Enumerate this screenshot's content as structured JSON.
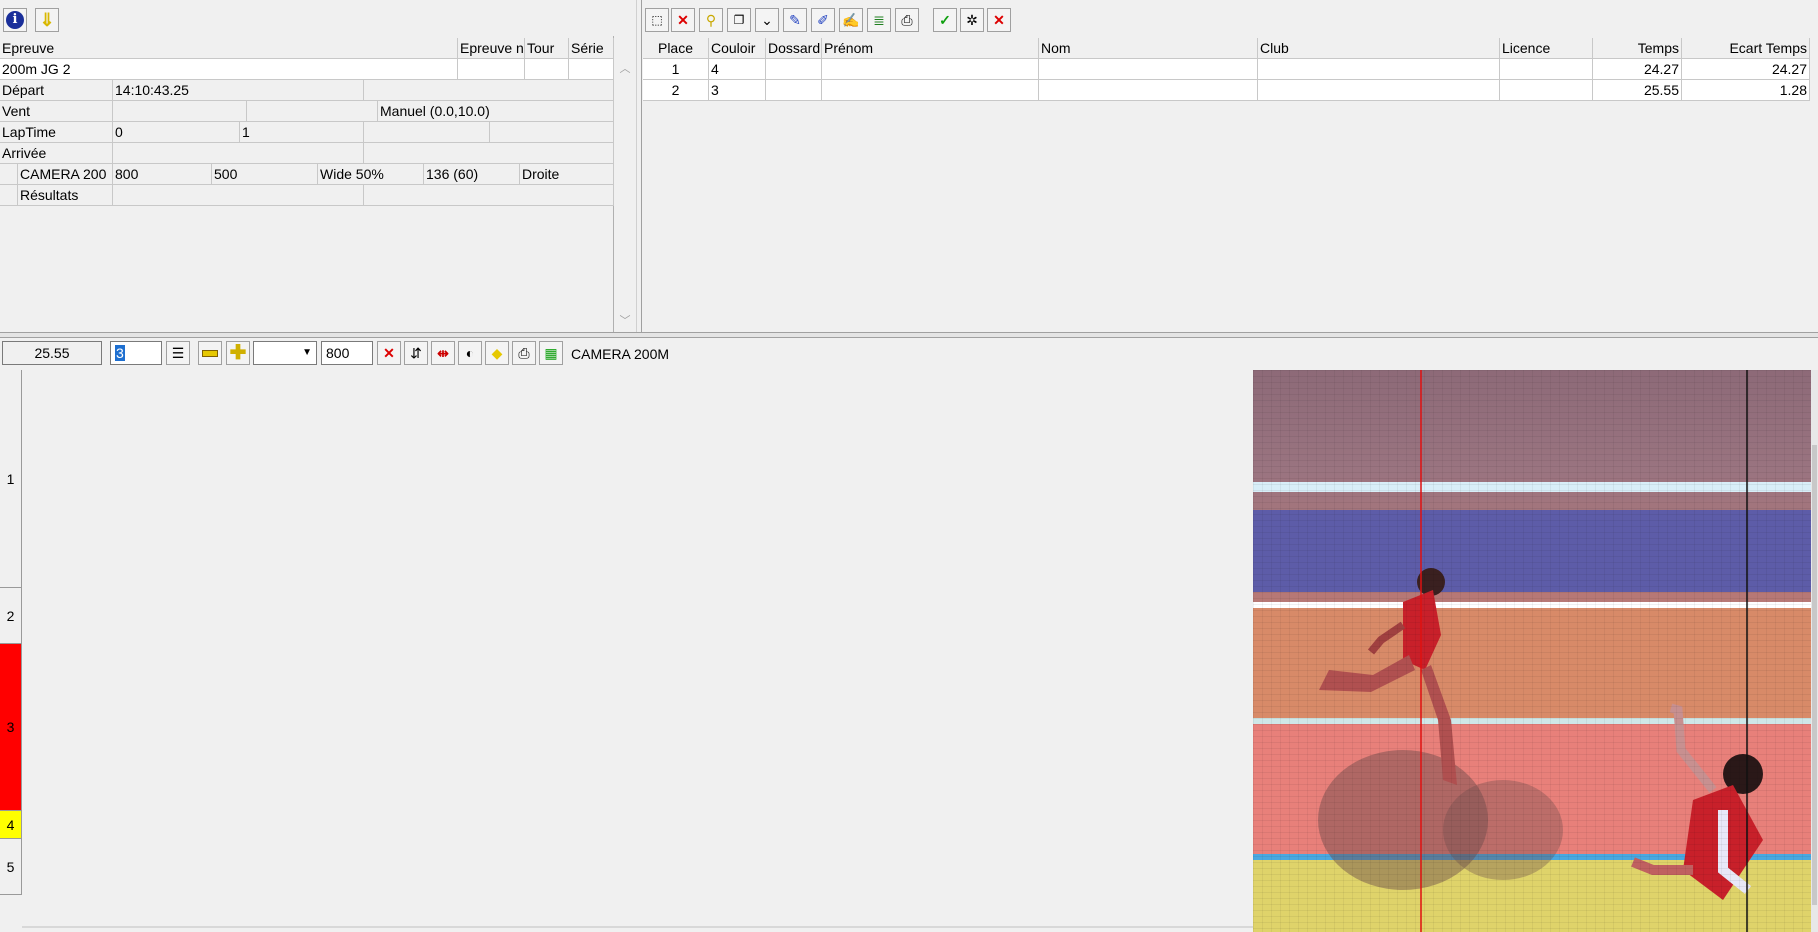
{
  "left_toolbar": {
    "icons": [
      "info-icon",
      "download-arrow-icon"
    ]
  },
  "event_panel": {
    "headers": {
      "epreuve": "Epreuve",
      "epreuve_n": "Epreuve n",
      "tour": "Tour",
      "serie": "Série"
    },
    "event_name": "200m JG 2",
    "rows": {
      "depart": {
        "label": "Départ",
        "value": "14:10:43.25"
      },
      "vent": {
        "label": "Vent",
        "value": "Manuel (0.0,10.0)"
      },
      "laptime": {
        "label": "LapTime",
        "v1": "0",
        "v2": "1"
      },
      "arrivee": {
        "label": "Arrivée"
      },
      "camera": {
        "label": "CAMERA 200",
        "v1": "800",
        "v2": "500",
        "v3": "Wide 50%",
        "v4": "136  (60)",
        "v5": "Droite"
      },
      "resultats": {
        "label": "Résultats"
      }
    }
  },
  "results_table": {
    "columns": [
      "Place",
      "Couloir",
      "Dossard",
      "Prénom",
      "Nom",
      "Club",
      "Licence",
      "Temps",
      "Ecart Temps"
    ],
    "rows": [
      {
        "place": "1",
        "couloir": "4",
        "dossard": "",
        "prenom": "",
        "nom": "",
        "club": "",
        "licence": "",
        "temps": "24.27",
        "ecart": "24.27"
      },
      {
        "place": "2",
        "couloir": "3",
        "dossard": "",
        "prenom": "",
        "nom": "",
        "club": "",
        "licence": "",
        "temps": "25.55",
        "ecart": "1.28"
      }
    ]
  },
  "viewer_toolbar": {
    "time_value": "25.55",
    "lane_spin": "3",
    "zoom_value": "800",
    "camera_label": "CAMERA 200M"
  },
  "lanes": [
    "1",
    "2",
    "3",
    "4",
    "5"
  ],
  "colors": {
    "lane3": "#ff0000",
    "lane4": "#ffff00",
    "cursor_red": "#e01010",
    "cursor_black": "#111111"
  }
}
